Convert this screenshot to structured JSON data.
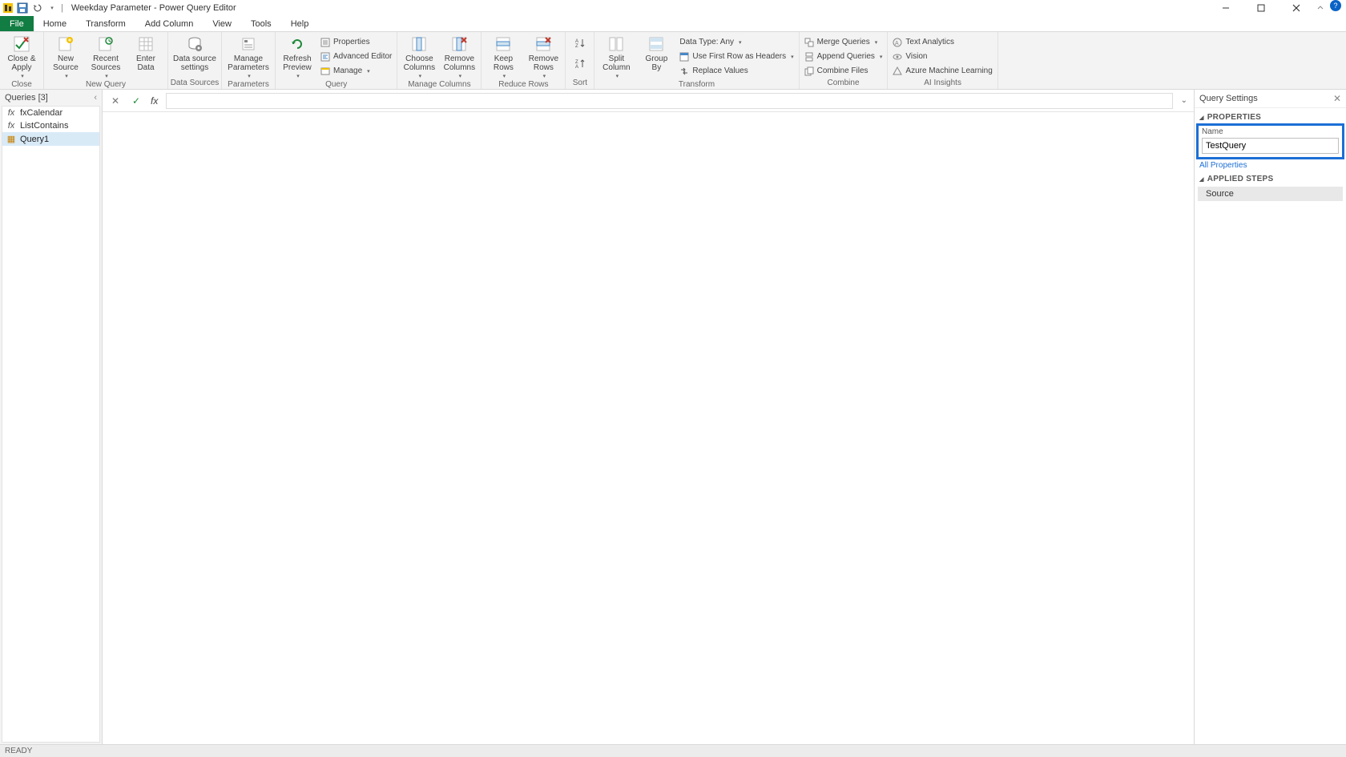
{
  "titlebar": {
    "title": "Weekday Parameter - Power Query Editor",
    "qat": {
      "save_title": "Save",
      "undo_title": "Undo",
      "redo_title": "Redo"
    }
  },
  "tabs": {
    "file": "File",
    "home": "Home",
    "transform": "Transform",
    "add_column": "Add Column",
    "view": "View",
    "tools": "Tools",
    "help": "Help"
  },
  "ribbon": {
    "close": {
      "close_apply": "Close &\nApply",
      "group": "Close"
    },
    "newquery": {
      "new_source": "New\nSource",
      "recent_sources": "Recent\nSources",
      "enter_data": "Enter\nData",
      "group": "New Query"
    },
    "datasources": {
      "ds_settings": "Data source\nsettings",
      "group": "Data Sources"
    },
    "parameters": {
      "manage_parameters": "Manage\nParameters",
      "group": "Parameters"
    },
    "query": {
      "refresh_preview": "Refresh\nPreview",
      "properties": "Properties",
      "advanced_editor": "Advanced Editor",
      "manage": "Manage",
      "group": "Query"
    },
    "managecols": {
      "choose_columns": "Choose\nColumns",
      "remove_columns": "Remove\nColumns",
      "group": "Manage Columns"
    },
    "reducerows": {
      "keep_rows": "Keep\nRows",
      "remove_rows": "Remove\nRows",
      "group": "Reduce Rows"
    },
    "sort": {
      "group": "Sort"
    },
    "transform": {
      "split_column": "Split\nColumn",
      "group_by": "Group\nBy",
      "data_type": "Data Type: Any",
      "first_row_headers": "Use First Row as Headers",
      "replace_values": "Replace Values",
      "group": "Transform"
    },
    "combine": {
      "merge": "Merge Queries",
      "append": "Append Queries",
      "combine_files": "Combine Files",
      "group": "Combine"
    },
    "ai": {
      "text_analytics": "Text Analytics",
      "vision": "Vision",
      "azure_ml": "Azure Machine Learning",
      "group": "AI Insights"
    }
  },
  "queries": {
    "header": "Queries [3]",
    "items": [
      {
        "icon": "fx",
        "label": "fxCalendar"
      },
      {
        "icon": "fx",
        "label": "ListContains"
      },
      {
        "icon": "tbl",
        "label": "Query1"
      }
    ]
  },
  "formula": {
    "value": ""
  },
  "settings": {
    "title": "Query Settings",
    "properties_header": "PROPERTIES",
    "name_label": "Name",
    "name_value": "TestQuery",
    "all_properties": "All Properties",
    "applied_steps_header": "APPLIED STEPS",
    "steps": [
      "Source"
    ]
  },
  "status": {
    "ready": "READY"
  }
}
